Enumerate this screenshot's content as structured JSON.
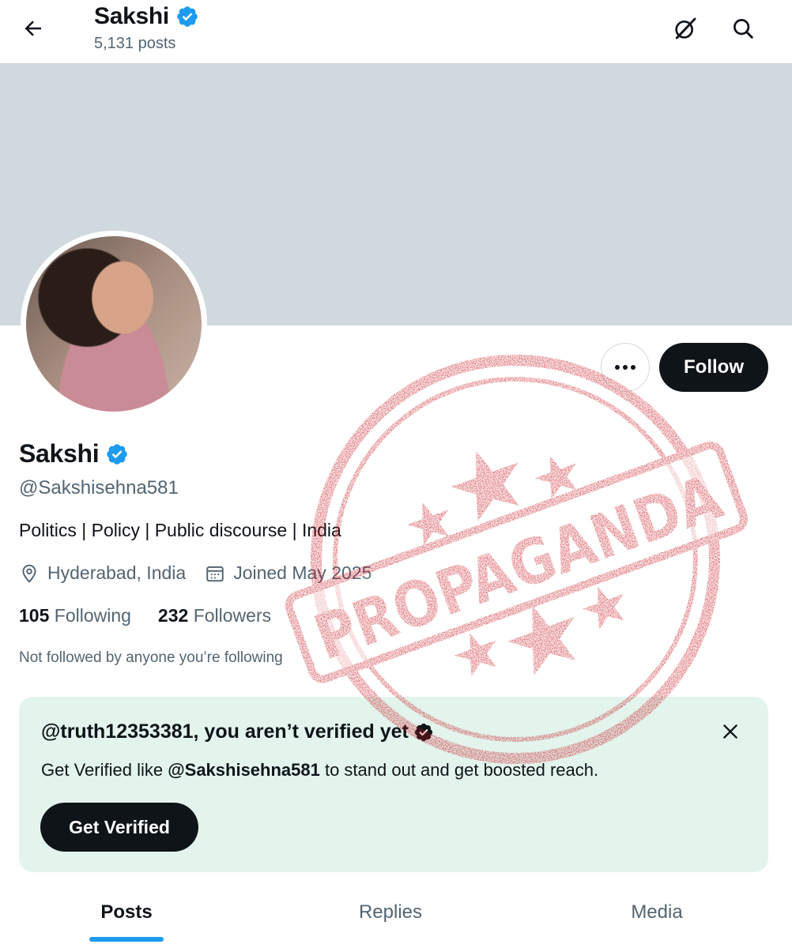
{
  "header": {
    "title": "Sakshi",
    "post_count": "5,131 posts"
  },
  "profile": {
    "display_name": "Sakshi",
    "handle": "@Sakshisehna581",
    "bio": "Politics | Policy | Public discourse | India",
    "location": "Hyderabad, India",
    "joined": "Joined May 2025",
    "following_count": "105",
    "following_label": "Following",
    "followers_count": "232",
    "followers_label": "Followers",
    "mutual_note": "Not followed by anyone you’re following"
  },
  "actions": {
    "follow_label": "Follow"
  },
  "verify_card": {
    "title": "@truth12353381, you aren’t verified yet",
    "text_before": "Get Verified like ",
    "text_handle": "@Sakshisehna581",
    "text_after": " to stand out and get boosted reach.",
    "button_label": "Get Verified"
  },
  "tabs": [
    {
      "label": "Posts",
      "active": true
    },
    {
      "label": "Replies",
      "active": false
    },
    {
      "label": "Media",
      "active": false
    }
  ],
  "stamp": {
    "text": "PROPAGANDA",
    "color": "#c8141e"
  },
  "colors": {
    "verified_badge": "#1d9bf0",
    "text_primary": "#0f1419",
    "text_secondary": "#536471",
    "banner": "#cfd9de",
    "card_bg": "#e3f4ec"
  },
  "icons": {
    "back": "arrow-left-icon",
    "grok": "grok-icon",
    "search": "search-icon",
    "location": "location-pin-icon",
    "calendar": "calendar-icon",
    "close": "close-icon",
    "more": "more-icon"
  }
}
